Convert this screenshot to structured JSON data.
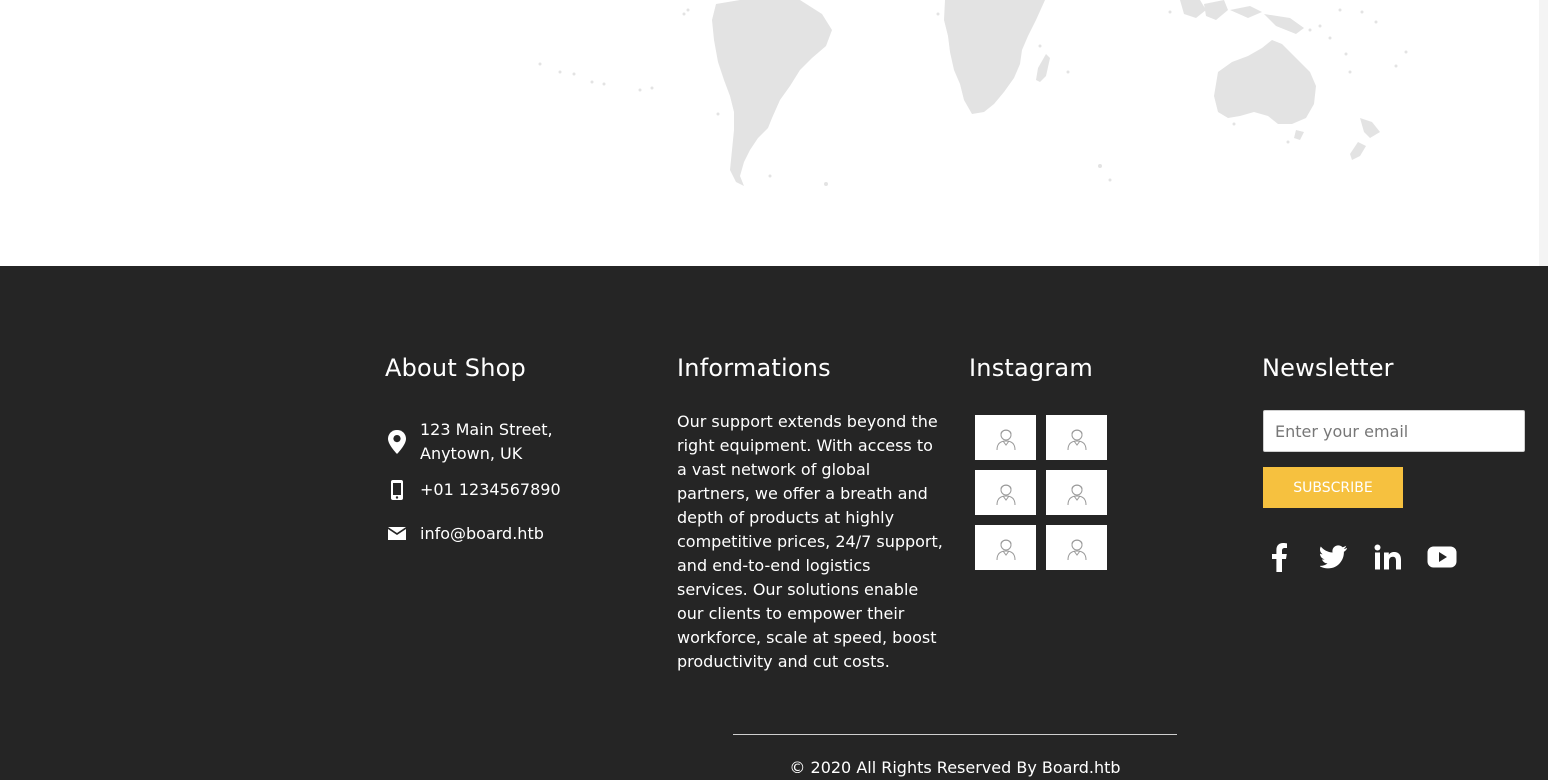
{
  "footer": {
    "about": {
      "title": "About Shop",
      "address_line1": "123 Main Street,",
      "address_line2": "Anytown, UK",
      "phone": "+01 1234567890",
      "email": "info@board.htb"
    },
    "informations": {
      "title": "Informations",
      "text": "Our support extends beyond the right equipment. With access to a vast network of global partners, we offer a breath and depth of products at highly competitive prices, 24/7 support, and end-to-end logistics services. Our solutions enable our clients to empower their workforce, scale at speed, boost productivity and cut costs."
    },
    "instagram": {
      "title": "Instagram",
      "image_icon": "person-avatar-icon",
      "image_count": 6
    },
    "newsletter": {
      "title": "Newsletter",
      "email_placeholder": "Enter your email",
      "subscribe_label": "SUBSCRIBE",
      "social_icons": [
        "facebook-icon",
        "twitter-icon",
        "linkedin-icon",
        "youtube-icon"
      ]
    },
    "copyright": "© 2020 All Rights Reserved By Board.htb"
  },
  "colors": {
    "footer_bg": "#252525",
    "accent": "#f6c13f",
    "map_land": "#e3e3e3",
    "text": "#ffffff"
  }
}
